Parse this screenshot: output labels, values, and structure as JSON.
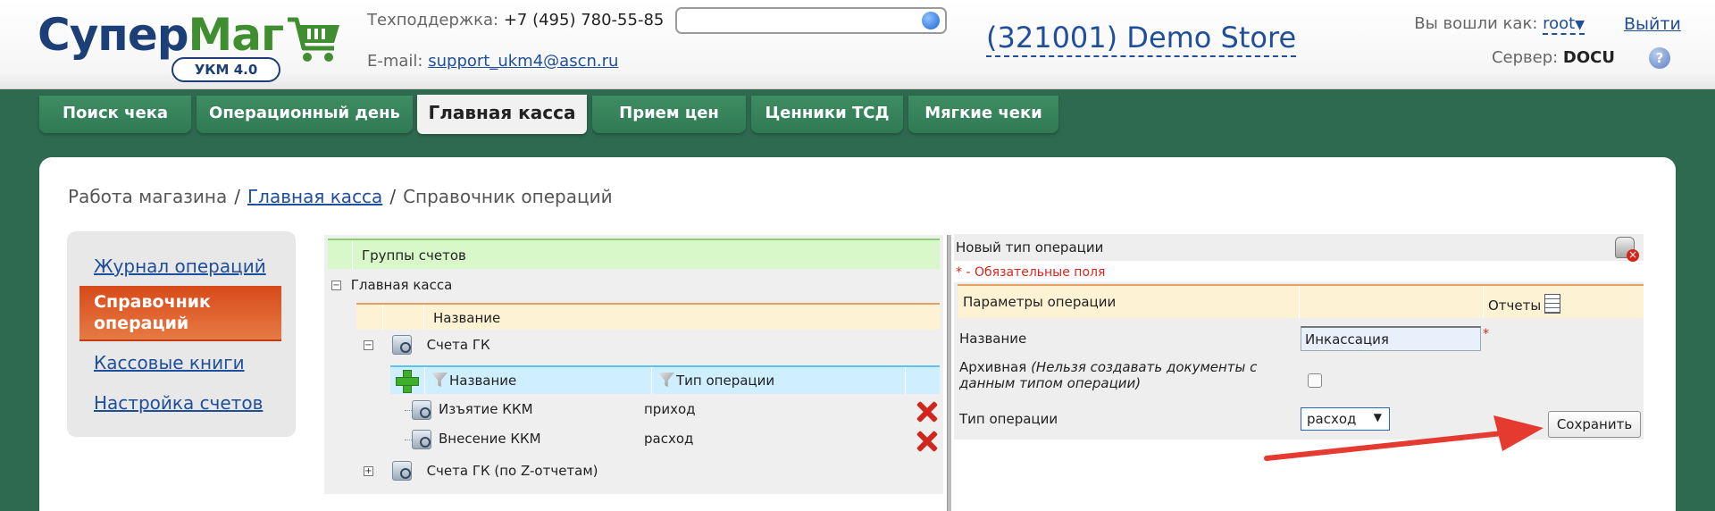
{
  "logo": {
    "part1": "Супер",
    "part2": "Маг",
    "badge": "УКМ 4.0"
  },
  "header": {
    "support_label": "Техподдержка:",
    "support_phone": "+7 (495) 780-55-85",
    "email_label": "E-mail:",
    "email": "support_ukm4@ascn.ru",
    "search_value": "",
    "store": "(321001) Demo Store",
    "logged_in_label": "Вы вошли как:",
    "user": "root",
    "user_caret": "▼",
    "logout": "Выйти",
    "server_label": "Сервер:",
    "server": "DOCU",
    "help": "?"
  },
  "tabs": [
    {
      "label": "Поиск чека"
    },
    {
      "label": "Операционный день"
    },
    {
      "label": "Главная касса"
    },
    {
      "label": "Прием цен"
    },
    {
      "label": "Ценники ТСД"
    },
    {
      "label": "Мягкие чеки"
    }
  ],
  "breadcrumb": {
    "root": "Работа магазина",
    "parent": "Главная касса",
    "current": "Справочник операций",
    "sep": "/"
  },
  "leftnav": [
    {
      "label": "Журнал операций"
    },
    {
      "label": "Справочник операций"
    },
    {
      "label": "Кассовые книги"
    },
    {
      "label": "Настройка счетов"
    }
  ],
  "tree": {
    "groups_header": "Группы счетов",
    "root": "Главная касса",
    "name_col": "Название",
    "gk": "Счета ГК",
    "sub_name_col": "Название",
    "sub_type_col": "Тип операции",
    "rows": [
      {
        "name": "Изъятие ККМ",
        "type": "приход"
      },
      {
        "name": "Внесение ККМ",
        "type": "расход"
      }
    ],
    "gk_z": "Счета ГК (по Z-отчетам)"
  },
  "form": {
    "title": "Новый тип операции",
    "required_note": "* - Обязательные поля",
    "params_header": "Параметры операции",
    "reports": "Отчеты",
    "name_label": "Название",
    "name_value": "Инкассация",
    "required_star": "*",
    "archive_label": "Архивная",
    "archive_hint": "(Нельзя создавать документы с данным типом операции)",
    "type_label": "Тип операции",
    "type_value": "расход",
    "type_caret": "▼",
    "save": "Сохранить"
  },
  "colors": {
    "background": "#2d6a50",
    "tab": "#2f7a53",
    "link": "#1f4f9a",
    "nav_active": "#d84a1a",
    "arrow": "#e53a2f"
  }
}
